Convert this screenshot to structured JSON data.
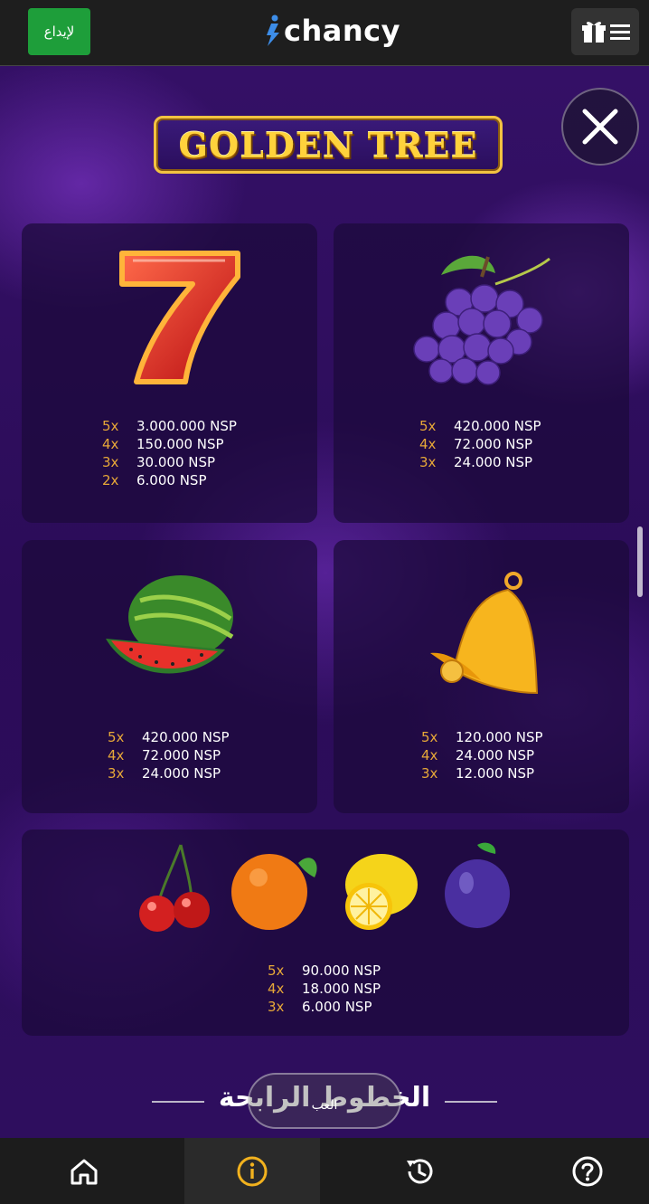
{
  "header": {
    "deposit_label": "لإيداع",
    "logo_text": "chancy",
    "menu_icon": "gift-menu-icon"
  },
  "game": {
    "title": "GOLDEN TREE",
    "close_icon": "close-icon"
  },
  "paytable": {
    "cards": [
      {
        "symbol": "seven",
        "payouts": [
          {
            "mult": "5x",
            "amount": "3.000.000 NSP"
          },
          {
            "mult": "4x",
            "amount": "150.000 NSP"
          },
          {
            "mult": "3x",
            "amount": "30.000 NSP"
          },
          {
            "mult": "2x",
            "amount": "6.000 NSP"
          }
        ]
      },
      {
        "symbol": "grapes",
        "payouts": [
          {
            "mult": "5x",
            "amount": "420.000 NSP"
          },
          {
            "mult": "4x",
            "amount": "72.000 NSP"
          },
          {
            "mult": "3x",
            "amount": "24.000 NSP"
          }
        ]
      },
      {
        "symbol": "watermelon",
        "payouts": [
          {
            "mult": "5x",
            "amount": "420.000 NSP"
          },
          {
            "mult": "4x",
            "amount": "72.000 NSP"
          },
          {
            "mult": "3x",
            "amount": "24.000 NSP"
          }
        ]
      },
      {
        "symbol": "bell",
        "payouts": [
          {
            "mult": "5x",
            "amount": "120.000 NSP"
          },
          {
            "mult": "4x",
            "amount": "24.000 NSP"
          },
          {
            "mult": "3x",
            "amount": "12.000 NSP"
          }
        ]
      },
      {
        "symbol": "cherry-orange-lemon-plum",
        "payouts": [
          {
            "mult": "5x",
            "amount": "90.000 NSP"
          },
          {
            "mult": "4x",
            "amount": "18.000 NSP"
          },
          {
            "mult": "3x",
            "amount": "6.000 NSP"
          }
        ]
      }
    ]
  },
  "section": {
    "heading": "الخطوط الرابحة",
    "pill_label": "العب"
  },
  "bottom_nav": {
    "items": [
      {
        "icon": "home-icon"
      },
      {
        "icon": "info-icon"
      },
      {
        "icon": "history-icon"
      },
      {
        "icon": "help-icon"
      }
    ]
  },
  "colors": {
    "accent_green": "#1e9e3a",
    "gold": "#ffd23c",
    "multiplier": "#e7a838",
    "background_purple": "#2a0f55"
  }
}
